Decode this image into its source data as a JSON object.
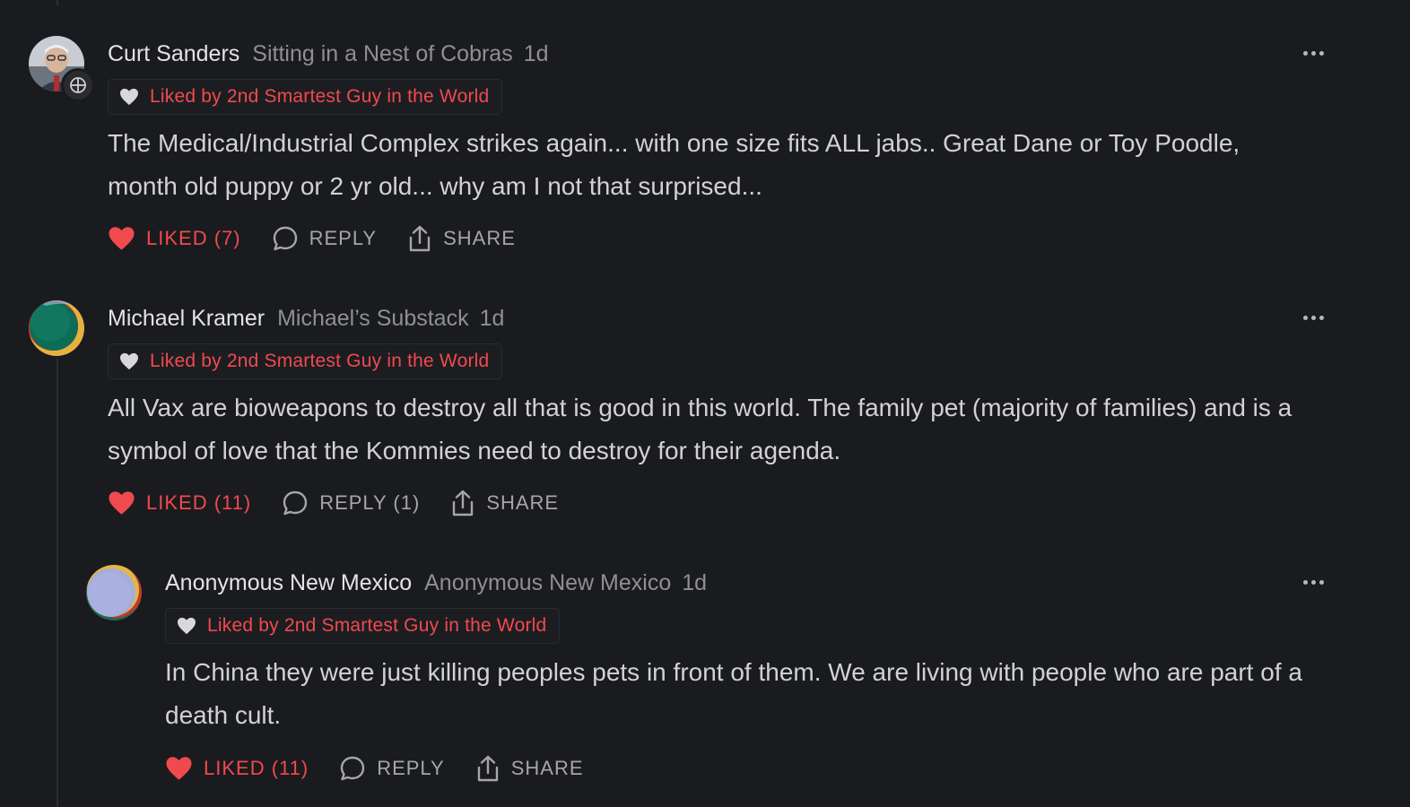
{
  "colors": {
    "background": "#1a1b1e",
    "liked_red": "#f04a4e",
    "muted_text": "#8f8f94",
    "author_text": "#e4e4e4"
  },
  "comments": [
    {
      "author": "Curt Sanders",
      "publication": "Sitting in a Nest of Cobras",
      "time": "1d",
      "liked_by": "Liked by 2nd Smartest Guy in the World",
      "body": "The Medical/Industrial Complex strikes again... with one size fits ALL jabs.. Great Dane or Toy Poodle, month old puppy or 2 yr old... why am I not that surprised...",
      "like_label": "LIKED (7)",
      "reply_label": "REPLY",
      "share_label": "SHARE",
      "avatar": "photo-avatar",
      "more_icon": "more-options-icon"
    },
    {
      "author": "Michael Kramer",
      "publication": "Michael’s Substack",
      "time": "1d",
      "liked_by": "Liked by 2nd Smartest Guy in the World",
      "body": "All Vax are bioweapons to destroy all that is good in this world. The family pet (majority of families) and is a symbol of love that the Kommies need to destroy for their agenda.",
      "like_label": "LIKED (11)",
      "reply_label": "REPLY (1)",
      "share_label": "SHARE",
      "avatar": "green-gradient-avatar",
      "more_icon": "more-options-icon"
    },
    {
      "author": "Anonymous New Mexico",
      "publication": "Anonymous New Mexico",
      "time": "1d",
      "liked_by": "Liked by 2nd Smartest Guy in the World",
      "body": "In China they were just killing peoples pets in front of them. We are living with people who are part of a death cult.",
      "like_label": "LIKED (11)",
      "reply_label": "REPLY",
      "share_label": "SHARE",
      "avatar": "lavender-gradient-avatar",
      "more_icon": "more-options-icon"
    }
  ]
}
